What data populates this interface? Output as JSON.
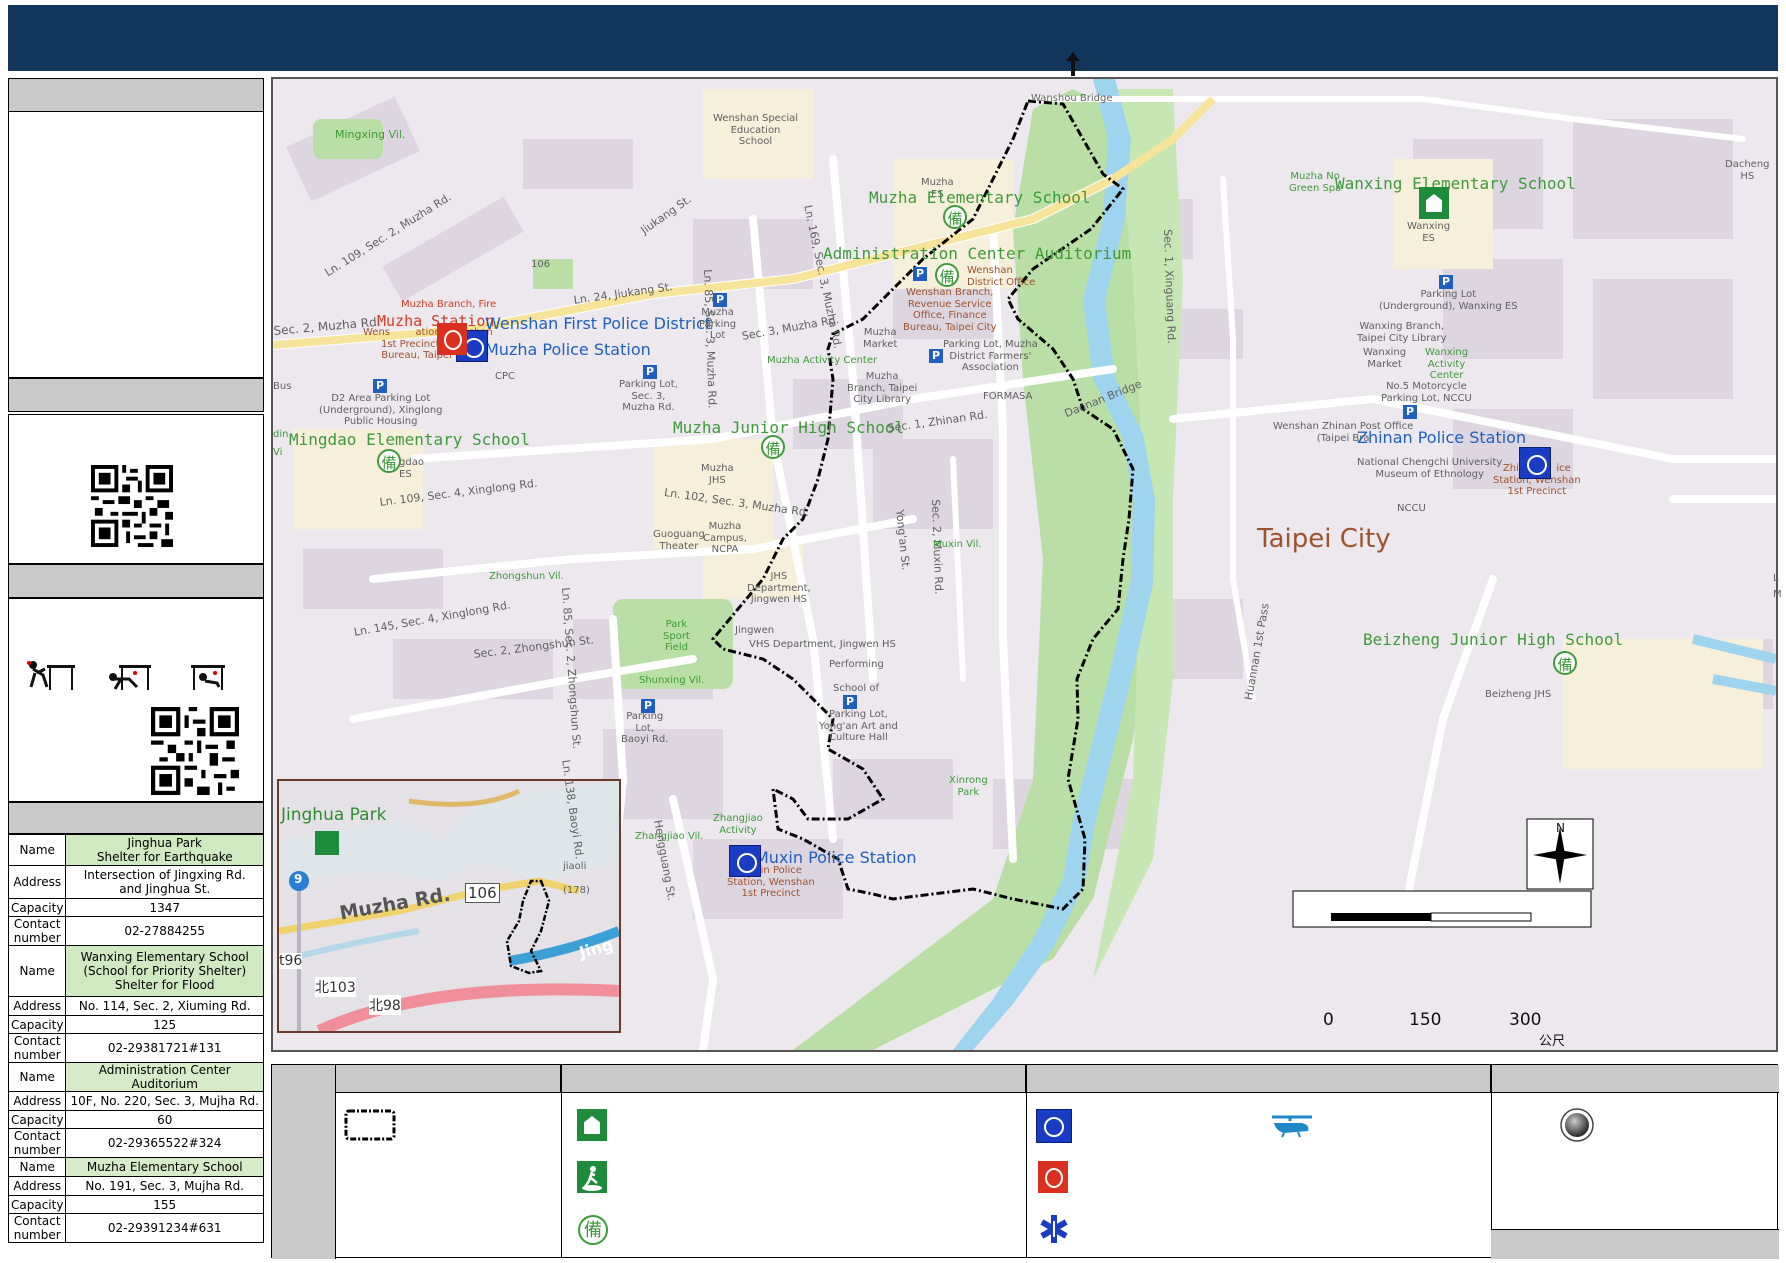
{
  "inset": {
    "labels": {
      "park": "Jinghua Park",
      "road": "Muzha Rd.",
      "r106": "106",
      "r9": "9",
      "t96": "t96",
      "t103": "北103",
      "t98": "北98",
      "river": "Jing"
    }
  },
  "shelters": [
    {
      "name_label": "Name",
      "name": "Jinghua Park\nShelter for Earthquake",
      "address_label": "Address",
      "address": "Intersection of Jingxing Rd.\nand Jinghua St.",
      "capacity_label": "Capacity",
      "capacity": "1347",
      "contact_label": "Contact\nnumber",
      "contact": "02-27884255"
    },
    {
      "name_label": "Name",
      "name": "Wanxing Elementary School\n(School for Priority Shelter)\nShelter for Flood",
      "address_label": "Address",
      "address": "No. 114, Sec. 2, Xiuming Rd.",
      "capacity_label": "Capacity",
      "capacity": "125",
      "contact_label": "Contact\nnumber",
      "contact": "02-29381721#131"
    },
    {
      "name_label": "Name",
      "name": "Administration Center Auditorium",
      "address_label": "Address",
      "address": "10F, No. 220, Sec. 3, Mujha Rd.",
      "capacity_label": "Capacity",
      "capacity": "60",
      "contact_label": "Contact\nnumber",
      "contact": "02-29365522#324"
    },
    {
      "name_label": "Name",
      "name": "Muzha Elementary School",
      "address_label": "Address",
      "address": "No. 191, Sec. 3, Mujha Rd.",
      "capacity_label": "Capacity",
      "capacity": "155",
      "contact_label": "Contact\nnumber",
      "contact": "02-29391234#631"
    }
  ],
  "map": {
    "scale": {
      "t0": "0",
      "t150": "150",
      "t300": "300",
      "unit": "公尺"
    },
    "compass": "N",
    "labels": {
      "mingxing": "Mingxing Vil.",
      "wenshan_special": "Wenshan Special\nEducation\nSchool",
      "wanshou_bridge": "Wanshou Bridge",
      "muzha_es_small": "Muzha\nES",
      "muzha_es": "Muzha Elementary School",
      "admin_center": "Administration Center Auditorium",
      "wenshan_dist": "Wenshan\nDistrict Office",
      "wenshan_branch": "Wenshan Branch,\nRevenue Service\nOffice, Finance\nBureau, Taipei City",
      "ln169": "Ln. 169, Sec. 3, Muzha Rd.",
      "ln85a": "Ln. 85, Sec. 3, Muzha Rd.",
      "jiukang": "Jiukang St.",
      "ln24": "Ln. 24, Jiukang St.",
      "ln109": "Ln. 109, Sec. 2, Muzha Rd.",
      "sec2muzha": "Sec. 2, Muzha Rd.",
      "r106": "106",
      "muzha_branch_fire": "Muzha Branch, Fire",
      "muzha_station": "Muzha Station",
      "wenshan_first": "Wenshan First Police District",
      "muzha_police": "Muzha Police Station",
      "precinct": "Wens        ation, Wenshan\n1st Precinct, Police\nBureau, Taipei City",
      "cpc": "CPC",
      "d2": "D2 Area Parking Lot\n(Underground), Xinglong\nPublic Housing",
      "bus": "Bus",
      "muzha_parking": "Muzha\nParking\nLot",
      "parking_sec3": "Parking Lot,\nSec. 3,\nMuzha Rd.",
      "sec3muzha": "Sec. 3, Muzha Rd.",
      "muzha_activity": "Muzha Activity Center",
      "muzha_market": "Muzha\nMarket",
      "muzha_lib": "Muzha\nBranch, Taipei\nCity Library",
      "farmers": "Parking Lot, Muzha\nDistrict Farmers'\nAssociation",
      "formosa": "FORMASA",
      "mingdao": "Mingdao Elementary School",
      "mingdao_small": "gdao\nES",
      "muzha_jhs": "Muzha Junior High School",
      "muzha_jhs_small": "Muzha\nJHS",
      "sec1zhinan": "Sec. 1, Zhinan Rd.",
      "ln109x": "Ln. 109, Sec. 4, Xinglong Rd.",
      "ln102": "Ln. 102, Sec. 3, Muzha Rd.",
      "ln85b": "Ln. 85, Sec. 2, Zhongshun St.",
      "yongan": "Yong'an St.",
      "sec2muxin": "Sec. 2, Muxin Rd.",
      "guoguang": "Guoguang\nTheater",
      "muzha_campus": "Muzha\nCampus,\nNCPA",
      "zhongshun": "Zhongshun Vil.",
      "muxin_vil": "Muxin Vil.",
      "jhs_dept": "JHS\nDepartment,\nJingwen HS",
      "park_sport": "Park\nSport\nField",
      "ln145": "Ln. 145, Sec. 4, Xinglong Rd.",
      "sec2zhongshun": "Sec. 2, Zhongshun St.",
      "jingwen": "Jingwen",
      "vhs": "VHS Department, Jingwen HS",
      "performing": "Performing",
      "school_of": "School of",
      "shunxing": "Shunxing Vil.",
      "parking_baoyi": "Parking\nLot,\nBaoyi Rd.",
      "ln138": "Ln. 138, Baoyi Rd.",
      "parking_yongan": "Parking Lot,\nYong'an Art and\nCulture Hall",
      "hengguang": "Hengguang St.",
      "zhangjiao_act": "Zhangjiao\nActivity",
      "zhangjiao_vil": "Zhangjiao Vil.",
      "muxin_police": "Muxin Police Station",
      "muxin_precinct": "Muxin Police\nStation, Wenshan\n1st Precinct",
      "xinrong": "Xinrong\nPark",
      "daonan": "Daonan Bridge",
      "jiaoli": "jiaoli",
      "n178": "(178)",
      "wanxing_es": "Wanxing Elementary School",
      "wanxing_es_small": "Wanxing\nES",
      "muzha_green": "Muzha No\nGreen Spa",
      "dacheng": "Dacheng\nHS",
      "sec1xinguang": "Sec. 1, Xinguang Rd.",
      "parking_wanxing": "Parking Lot\n(Underground), Wanxing ES",
      "wanxing_lib": "Wanxing Branch,\nTaipei City Library",
      "wanxing_market": "Wanxing\nMarket",
      "wanxing_act": "Wanxing\nActivity\nCenter",
      "moto_parking": "No.5 Motorcycle\nParking Lot, NCCU",
      "zhinan_post": "Wenshan Zhinan Post Office\n(Taipei Bra",
      "zhinan_police": "Zhinan Police Station",
      "zhinan_precinct": "Zhinan P   ice\nStation, Wenshan\n1st Precinct",
      "nccu_museum": "National Chengchi University\nMuseum of Ethnology",
      "nccu": "NCCU",
      "taipei_city": "Taipei City",
      "beizheng": "Beizheng Junior High School",
      "beizheng_small": "Beizheng JHS",
      "huannan": "Huannan 1st Pass",
      "bei": "備",
      "vi": "Vi",
      "m": "M",
      "l": "L",
      "din": "din"
    }
  },
  "legend": {}
}
